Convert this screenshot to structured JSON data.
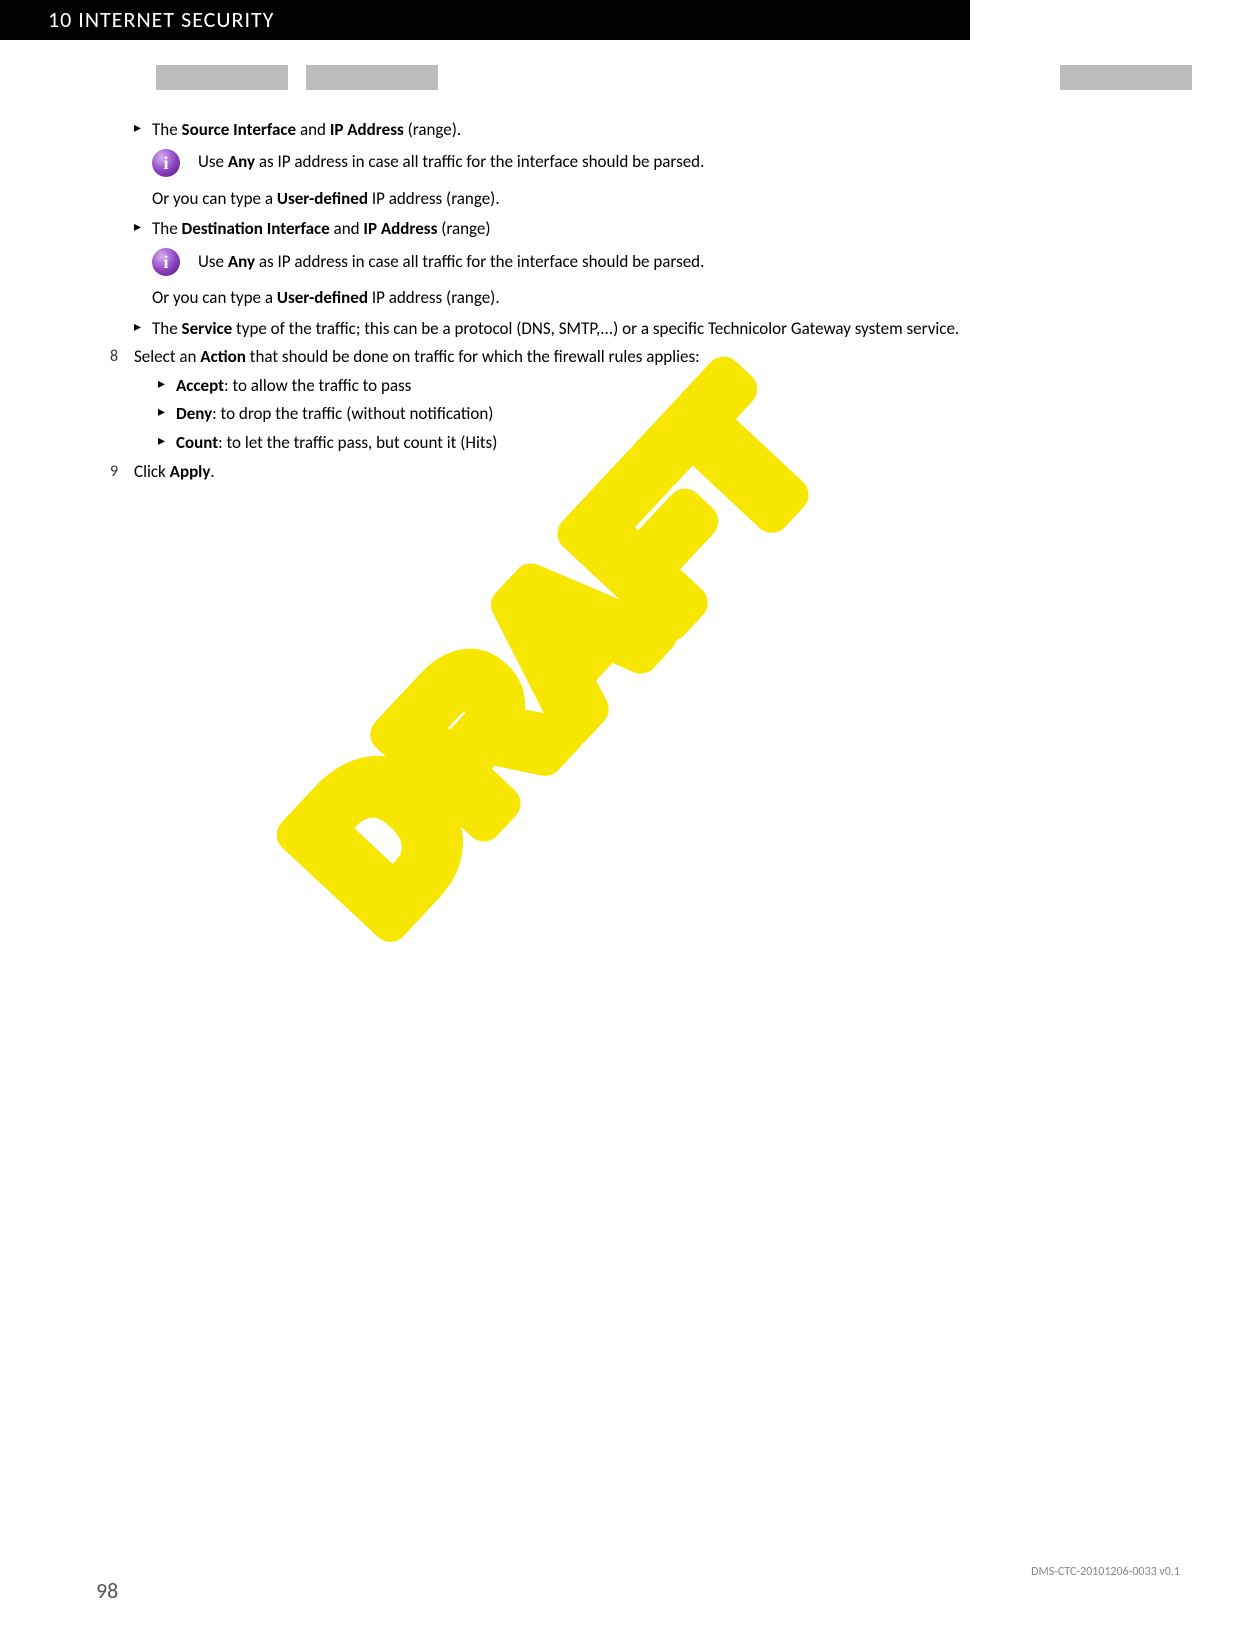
{
  "header": {
    "chapter_number": "10",
    "chapter_title": "INTERNET SECURITY"
  },
  "body": {
    "item1_pre": "The ",
    "item1_b1": "Source Interface",
    "item1_mid": " and ",
    "item1_b2": "IP Address",
    "item1_post": " (range).",
    "note1_pre": "Use ",
    "note1_b": "Any",
    "note1_post": " as IP address in case all traffic for the interface should be parsed.",
    "sub1_pre": "Or you can type a ",
    "sub1_b": "User-defined",
    "sub1_post": " IP address (range).",
    "item2_pre": "The ",
    "item2_b1": "Destination Interface",
    "item2_mid": " and ",
    "item2_b2": "IP Address",
    "item2_post": " (range)",
    "note2_pre": "Use ",
    "note2_b": "Any",
    "note2_post": " as IP address in case all traffic for the interface should be parsed.",
    "sub2_pre": "Or you can type a ",
    "sub2_b": "User-defined",
    "sub2_post": " IP address (range).",
    "item3_pre": "The ",
    "item3_b": "Service",
    "item3_post": " type of the traffic; this can be a protocol (DNS, SMTP,...) or a specific Technicolor Gateway system service.",
    "step8_num": "8",
    "step8_pre": "Select an ",
    "step8_b": "Action",
    "step8_post": " that should be done on traffic for which the firewall rules applies:",
    "action1_b": "Accept",
    "action1_post": ": to allow the traffic to pass",
    "action2_b": "Deny",
    "action2_post": ": to drop the traffic (without notification)",
    "action3_b": "Count",
    "action3_post": ": to let the traffic pass, but count it (Hits)",
    "step9_num": "9",
    "step9_pre": "Click ",
    "step9_b": "Apply",
    "step9_post": "."
  },
  "watermark": "DRAFT",
  "footer": {
    "page_number": "98",
    "doc_id": "DMS-CTC-20101206-0033 v0.1"
  }
}
